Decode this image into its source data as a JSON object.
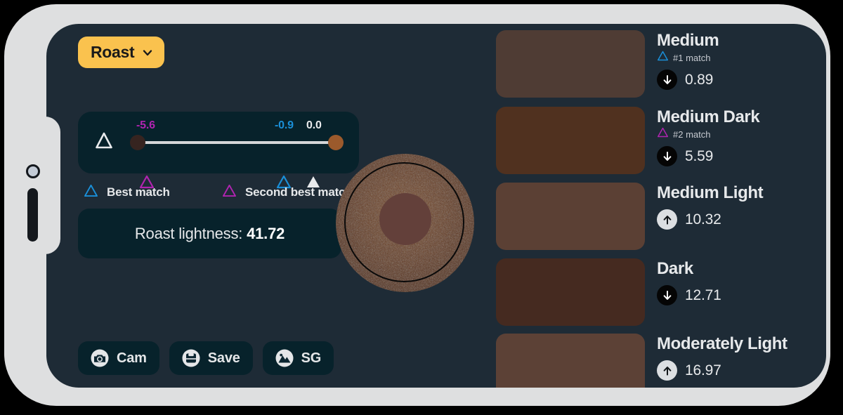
{
  "app": {
    "dropdown": {
      "label": "Roast",
      "icon": "chevron-down-icon"
    },
    "colors": {
      "accent": "#fac24e",
      "screen_bg": "#1e2b36",
      "card_bg": "#07222b",
      "frame": "#dedfe0",
      "best_match": "#1a8fd8",
      "second_best_match": "#b024b0"
    }
  },
  "slider": {
    "left_icon": "delta-triangle-icon",
    "left_knob_color": "#362420",
    "right_knob_color": "#9b5a2c",
    "markers": [
      {
        "name": "second-best",
        "value": "-5.6",
        "color": "#b024b0",
        "shape": "triangle-outline",
        "pos_pct": 2
      },
      {
        "name": "best",
        "value": "-0.9",
        "color": "#1a8fd8",
        "shape": "triangle-outline",
        "pos_pct": 72
      },
      {
        "name": "current",
        "value": "0.0",
        "color": "#e8eaec",
        "shape": "triangle-filled",
        "pos_pct": 88
      }
    ]
  },
  "legend": {
    "items": [
      {
        "label": "Best match",
        "color": "#1a8fd8",
        "icon": "triangle-outline-icon"
      },
      {
        "label": "Second best match",
        "color": "#b024b0",
        "icon": "triangle-outline-icon"
      }
    ]
  },
  "lightness": {
    "prefix": "Roast lightness: ",
    "value": "41.72"
  },
  "buttons": [
    {
      "label": "Cam",
      "icon": "camera-icon"
    },
    {
      "label": "Save",
      "icon": "save-disk-icon"
    },
    {
      "label": "SG",
      "icon": "mountain-image-icon"
    }
  ],
  "bean": {
    "name": "coffee-grounds-sample",
    "center_color": "#63403a"
  },
  "roast_list": [
    {
      "name": "Medium",
      "swatch": "#4f3c34",
      "match_rank": "#1 match",
      "match_color": "#1a8fd8",
      "score": "0.89",
      "direction": "down"
    },
    {
      "name": "Medium Dark",
      "swatch": "#50311f",
      "match_rank": "#2 match",
      "match_color": "#b024b0",
      "score": "5.59",
      "direction": "down"
    },
    {
      "name": "Medium Light",
      "swatch": "#5b4034",
      "match_rank": "",
      "match_color": "",
      "score": "10.32",
      "direction": "up"
    },
    {
      "name": "Dark",
      "swatch": "#452a20",
      "match_rank": "",
      "match_color": "",
      "score": "12.71",
      "direction": "down"
    },
    {
      "name": "Moderately Light",
      "swatch": "#5c4136",
      "match_rank": "",
      "match_color": "",
      "score": "16.97",
      "direction": "up"
    }
  ]
}
